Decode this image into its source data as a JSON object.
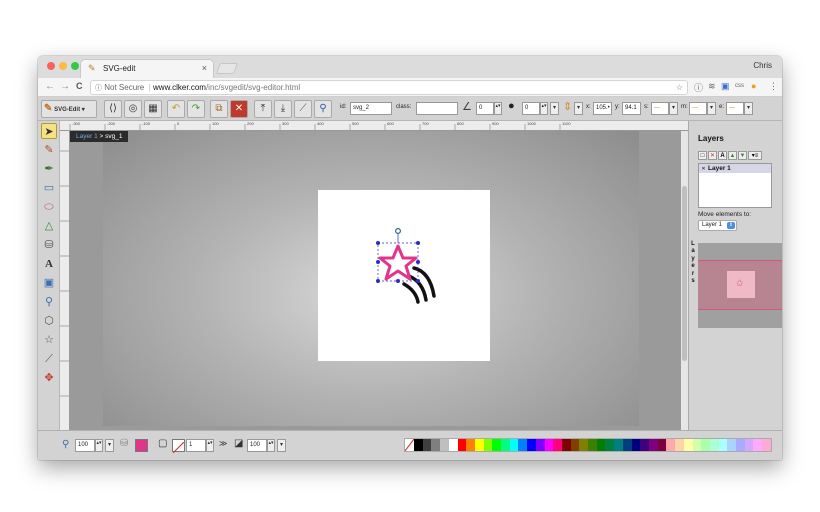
{
  "browser": {
    "tab_title": "SVG-edit",
    "tab_close": "×",
    "user": "Chris",
    "url_security": "Not Secure",
    "url_host": "www.clker.com",
    "url_path": "/inc/svgedit/svg-editor.html",
    "back_icon": "←",
    "forward_icon": "→",
    "reload_icon": "C"
  },
  "toolbar": {
    "logo_label": "SVG-Edit",
    "id_label": "id:",
    "id_value": "svg_2",
    "class_label": "class:",
    "class_value": "",
    "angle_value": "0",
    "blur_value": "0",
    "x_label": "x:",
    "x_value": "105.•",
    "y_label": "y:",
    "y_value": "94.1",
    "s_label": "s:",
    "m_label": "m:",
    "e_label": "e:"
  },
  "canvas": {
    "layer_name": "Layer 1",
    "breadcrumb_sep": " > ",
    "element_id": "svg_1",
    "ruler_ticks": [
      "-300",
      "-200",
      "-100",
      "0",
      "100",
      "200",
      "300",
      "400",
      "500",
      "600",
      "700",
      "800",
      "900",
      "1000",
      "1100"
    ],
    "star_color": "#e0358a"
  },
  "layers_panel": {
    "title": "Layers",
    "layer_row": "Layer 1",
    "move_label": "Move elements to:",
    "move_value": "Layer 1",
    "vertical_label": [
      "L",
      "a",
      "y",
      "e",
      "r",
      "s"
    ]
  },
  "bottom": {
    "zoom_value": "100",
    "stroke_width_value": "1",
    "opacity_value": "100",
    "fill_color": "#e0358a"
  },
  "palette_colors": [
    "#000000",
    "#3f3f3f",
    "#7f7f7f",
    "#bfbfbf",
    "#ffffff",
    "#ff0000",
    "#ff7f00",
    "#ffff00",
    "#7fff00",
    "#00ff00",
    "#00ff7f",
    "#00ffff",
    "#007fff",
    "#0000ff",
    "#7f00ff",
    "#ff00ff",
    "#ff007f",
    "#7f0000",
    "#7f3f00",
    "#7f7f00",
    "#3f7f00",
    "#007f00",
    "#007f3f",
    "#007f7f",
    "#003f7f",
    "#00007f",
    "#3f007f",
    "#7f007f",
    "#7f003f",
    "#ffaaaa",
    "#ffd4aa",
    "#ffffaa",
    "#d4ffaa",
    "#aaffaa",
    "#aaffd4",
    "#aaffff",
    "#aad4ff",
    "#aaaaff",
    "#d4aaff",
    "#ffaaff",
    "#ffaad4"
  ]
}
